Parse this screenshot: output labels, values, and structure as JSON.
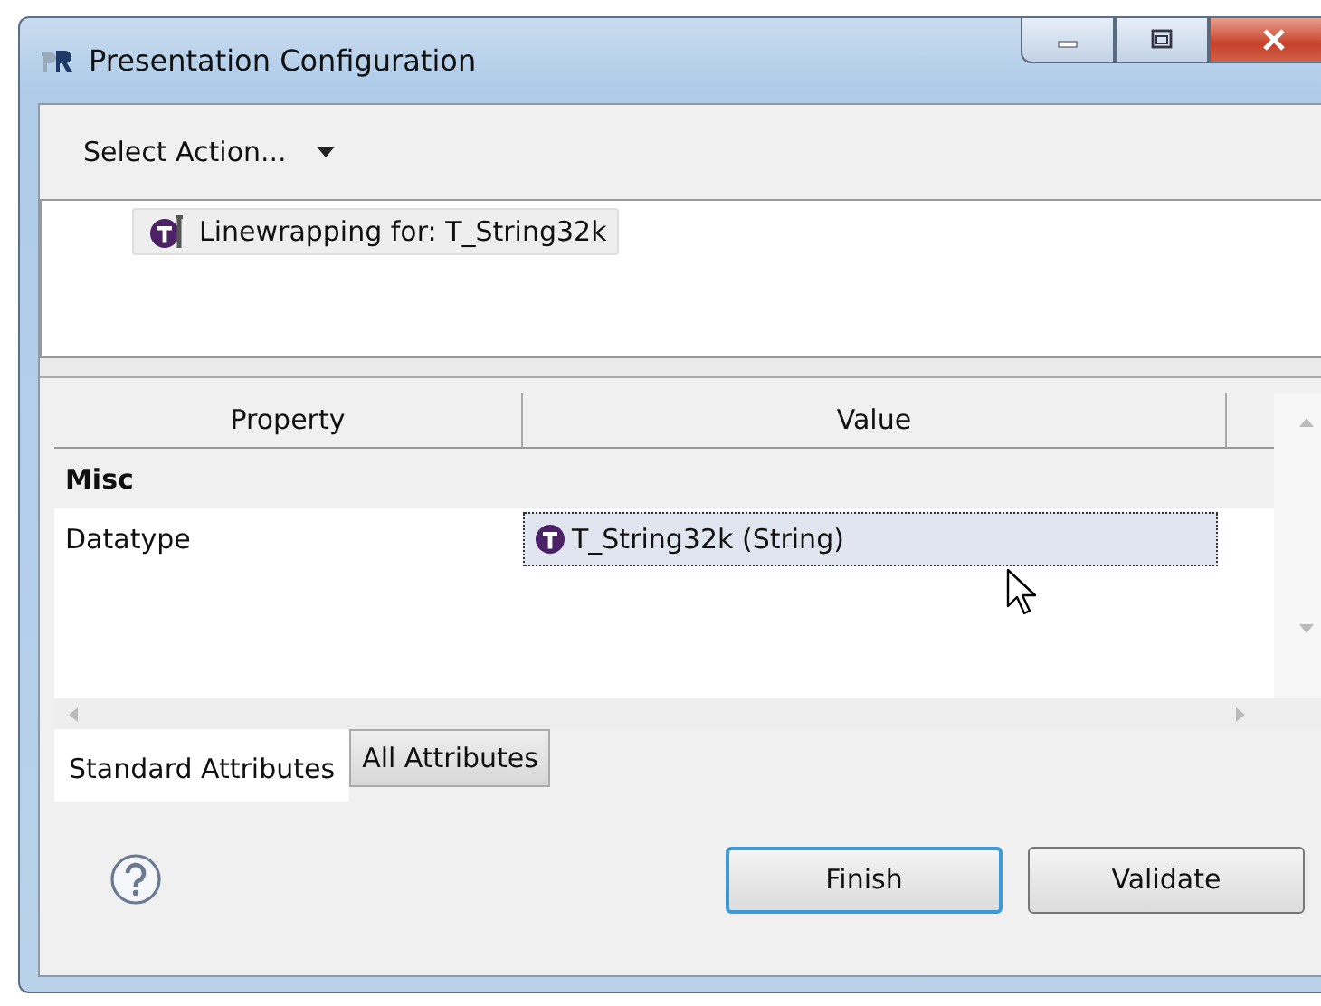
{
  "window": {
    "title": "Presentation Configuration"
  },
  "toolbar": {
    "label": "Select Action..."
  },
  "tree": {
    "items": [
      {
        "label": "Linewrapping for: T_String32k"
      }
    ]
  },
  "table": {
    "columns": [
      "Property",
      "Value"
    ],
    "rows": [
      {
        "kind": "category",
        "property": "Misc"
      },
      {
        "kind": "property",
        "property": "Datatype",
        "value": "T_String32k (String)",
        "selected": true
      }
    ]
  },
  "tabs": [
    {
      "label": "Standard Attributes",
      "selected": true
    },
    {
      "label": "All Attributes",
      "selected": false
    }
  ],
  "buttons": [
    {
      "label": "Finish",
      "default": true
    },
    {
      "label": "Validate",
      "default": false
    }
  ]
}
